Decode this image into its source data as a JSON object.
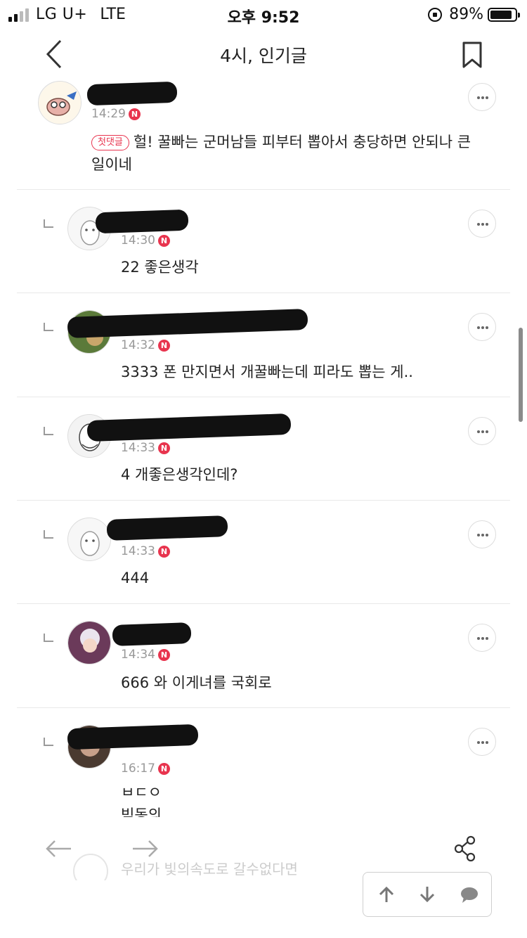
{
  "status_bar": {
    "carrier": "LG U+",
    "network": "LTE",
    "time": "오후 9:52",
    "battery": "89%",
    "battery_level": 0.89
  },
  "header": {
    "title": "4시, 인기글",
    "back_icon": "chevron-left-icon",
    "bookmark_icon": "bookmark-icon"
  },
  "comments": [
    {
      "is_reply": false,
      "time": "14:29",
      "new_badge": "N",
      "first_tag": "첫댓글",
      "text_line1": "헐! 꿀빠는 군머남들 피부터 뽑아서 충당하면 안되나 큰",
      "text_line2": "일이네"
    },
    {
      "is_reply": true,
      "time": "14:30",
      "new_badge": "N",
      "text_line1": "22 좋은생각"
    },
    {
      "is_reply": true,
      "time": "14:32",
      "new_badge": "N",
      "text_line1": "3333 폰 만지면서 개꿀빠는데 피라도 뽑는 게.."
    },
    {
      "is_reply": true,
      "time": "14:33",
      "new_badge": "N",
      "text_line1": "4 개좋은생각인데?"
    },
    {
      "is_reply": true,
      "time": "14:33",
      "new_badge": "N",
      "text_line1": "444"
    },
    {
      "is_reply": true,
      "time": "14:34",
      "new_badge": "N",
      "text_line1": "666 와 이게녀를 국회로"
    },
    {
      "is_reply": true,
      "time": "16:17",
      "new_badge": "N",
      "text_line1": "ㅂㄷㅇ",
      "text_line2": "빅동의"
    }
  ],
  "bottom_bar": {
    "prev_icon": "arrow-left-icon",
    "next_icon": "arrow-right-icon",
    "share_icon": "share-icon",
    "ghost_text": "우리가 빛의속도로 갈수없다면"
  },
  "float_nav": {
    "up_icon": "arrow-up-icon",
    "down_icon": "arrow-down-icon",
    "comment_icon": "speech-bubble-icon"
  },
  "colors": {
    "accent": "#e8344e",
    "divider": "#e9e9e9",
    "meta_text": "#999999"
  }
}
